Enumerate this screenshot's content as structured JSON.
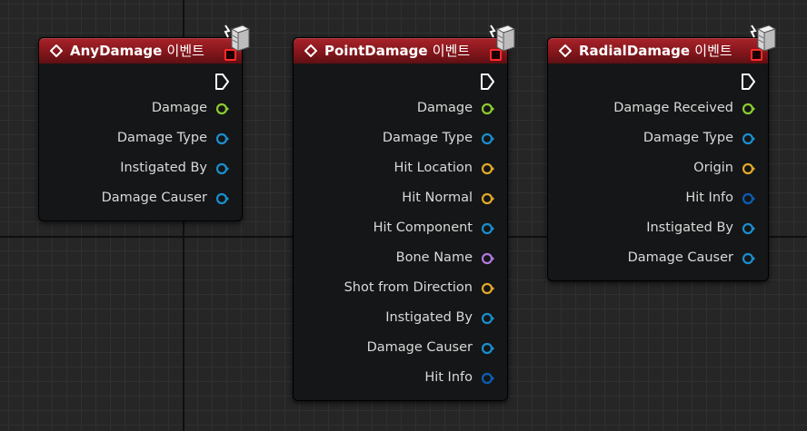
{
  "nodes": [
    {
      "id": "any",
      "title": "AnyDamage",
      "suffix": "이벤트",
      "pins": [
        {
          "label": "Damage",
          "color": "#8ccc30",
          "icon": "float-pin-icon"
        },
        {
          "label": "Damage Type",
          "color": "#1a8fd0",
          "icon": "object-pin-icon"
        },
        {
          "label": "Instigated By",
          "color": "#1a8fd0",
          "icon": "object-pin-icon"
        },
        {
          "label": "Damage Causer",
          "color": "#1a8fd0",
          "icon": "object-pin-icon"
        }
      ]
    },
    {
      "id": "point",
      "title": "PointDamage",
      "suffix": "이벤트",
      "pins": [
        {
          "label": "Damage",
          "color": "#8ccc30",
          "icon": "float-pin-icon"
        },
        {
          "label": "Damage Type",
          "color": "#1a8fd0",
          "icon": "object-pin-icon"
        },
        {
          "label": "Hit Location",
          "color": "#e2a92b",
          "icon": "vector-pin-icon"
        },
        {
          "label": "Hit Normal",
          "color": "#e2a92b",
          "icon": "vector-pin-icon"
        },
        {
          "label": "Hit Component",
          "color": "#1a8fd0",
          "icon": "object-pin-icon"
        },
        {
          "label": "Bone Name",
          "color": "#b07ae0",
          "icon": "name-pin-icon"
        },
        {
          "label": "Shot from Direction",
          "color": "#e2a92b",
          "icon": "vector-pin-icon"
        },
        {
          "label": "Instigated By",
          "color": "#1a8fd0",
          "icon": "object-pin-icon"
        },
        {
          "label": "Damage Causer",
          "color": "#1a8fd0",
          "icon": "object-pin-icon"
        },
        {
          "label": "Hit Info",
          "color": "#0c5eb8",
          "icon": "struct-pin-icon"
        }
      ]
    },
    {
      "id": "radial",
      "title": "RadialDamage",
      "suffix": "이벤트",
      "pins": [
        {
          "label": "Damage Received",
          "color": "#8ccc30",
          "icon": "float-pin-icon"
        },
        {
          "label": "Damage Type",
          "color": "#1a8fd0",
          "icon": "object-pin-icon"
        },
        {
          "label": "Origin",
          "color": "#e2a92b",
          "icon": "vector-pin-icon"
        },
        {
          "label": "Hit Info",
          "color": "#0c5eb8",
          "icon": "struct-pin-icon"
        },
        {
          "label": "Instigated By",
          "color": "#1a8fd0",
          "icon": "object-pin-icon"
        },
        {
          "label": "Damage Causer",
          "color": "#1a8fd0",
          "icon": "object-pin-icon"
        }
      ]
    }
  ]
}
